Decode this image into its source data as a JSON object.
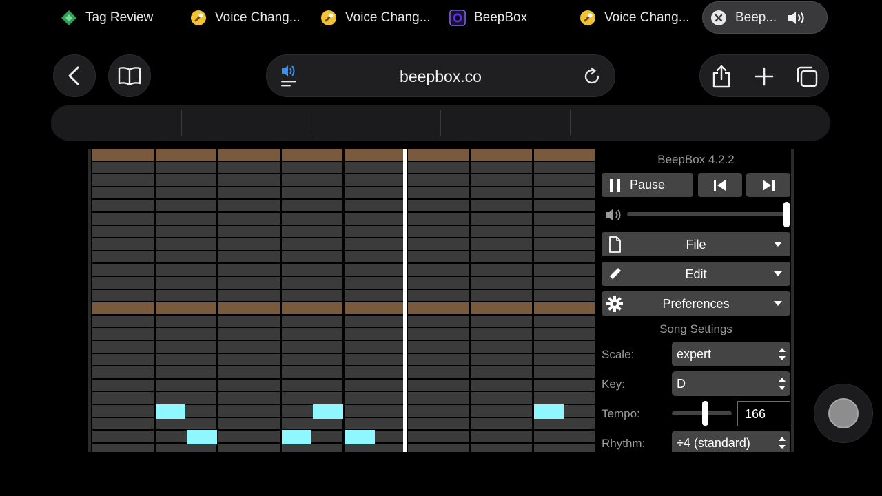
{
  "browser": {
    "url": "beepbox.co",
    "tabs": [
      {
        "label": "Tag Review",
        "icon": "diamond-tag-icon"
      },
      {
        "label": "Voice Chang...",
        "icon": "microphone-icon"
      },
      {
        "label": "Voice Chang...",
        "icon": "microphone-icon"
      },
      {
        "label": "BeepBox",
        "icon": "beepbox-logo-icon"
      },
      {
        "label": "Voice Chang...",
        "icon": "microphone-icon"
      },
      {
        "label": "Beep...",
        "icon": "close-icon",
        "active": true
      }
    ]
  },
  "beepbox": {
    "version": "BeepBox 4.2.2",
    "pause_label": "Pause",
    "menus": {
      "file": "File",
      "edit": "Edit",
      "preferences": "Preferences"
    },
    "volume_fraction": 1.0,
    "song_settings": {
      "title": "Song Settings",
      "scale_label": "Scale:",
      "scale_value": "expert",
      "key_label": "Key:",
      "key_value": "D",
      "tempo_label": "Tempo:",
      "tempo_value": "166",
      "rhythm_label": "Rhythm:",
      "rhythm_value": "÷4 (standard)"
    },
    "pattern_grid": {
      "bars": 8,
      "pitch_rows": 24,
      "highlighted_rows": [
        0,
        12
      ],
      "notes": [
        {
          "bar": 1,
          "row": 20,
          "start": 0,
          "length": 0.5
        },
        {
          "bar": 1,
          "row": 22,
          "start": 0.5,
          "length": 0.5
        },
        {
          "bar": 3,
          "row": 22,
          "start": 0,
          "length": 0.5
        },
        {
          "bar": 3,
          "row": 20,
          "start": 0.5,
          "length": 0.5
        },
        {
          "bar": 4,
          "row": 22,
          "start": 0,
          "length": 0.5
        },
        {
          "bar": 7,
          "row": 20,
          "start": 0,
          "length": 0.5
        }
      ],
      "playhead_bar_position": 4.95
    },
    "colors": {
      "note": "#8ef7ff",
      "highlight_row": "#7a5a3c",
      "cell": "#3b3b3b"
    }
  }
}
